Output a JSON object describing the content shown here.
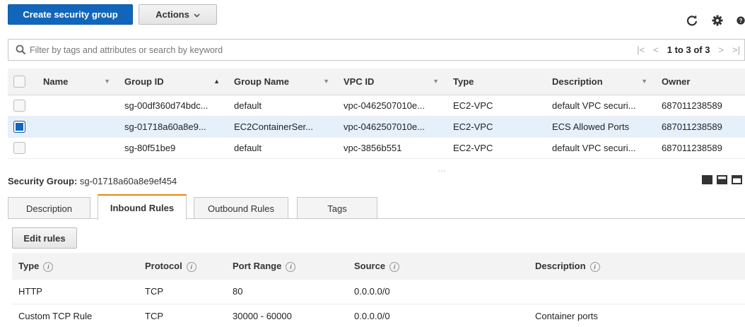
{
  "toolbar": {
    "create_label": "Create security group",
    "actions_label": "Actions",
    "icons": [
      "refresh-icon",
      "gear-icon",
      "help-icon"
    ]
  },
  "filter": {
    "placeholder": "Filter by tags and attributes or search by keyword",
    "pager_text": "1 to 3 of 3"
  },
  "grid": {
    "columns": [
      "Name",
      "Group ID",
      "Group Name",
      "VPC ID",
      "Type",
      "Description",
      "Owner"
    ],
    "rows": [
      {
        "name": "",
        "group_id": "sg-00df360d74bdc...",
        "group_name": "default",
        "vpc_id": "vpc-0462507010e...",
        "type": "EC2-VPC",
        "description": "default VPC securi...",
        "owner": "687011238589",
        "selected": false
      },
      {
        "name": "",
        "group_id": "sg-01718a60a8e9...",
        "group_name": "EC2ContainerSer...",
        "vpc_id": "vpc-0462507010e...",
        "type": "EC2-VPC",
        "description": "ECS Allowed Ports",
        "owner": "687011238589",
        "selected": true
      },
      {
        "name": "",
        "group_id": "sg-80f51be9",
        "group_name": "default",
        "vpc_id": "vpc-3856b551",
        "type": "EC2-VPC",
        "description": "default VPC securi...",
        "owner": "687011238589",
        "selected": false
      }
    ]
  },
  "detail": {
    "label": "Security Group:",
    "group_id": "sg-01718a60a8e9ef454",
    "tabs": [
      "Description",
      "Inbound Rules",
      "Outbound Rules",
      "Tags"
    ],
    "active_tab": "Inbound Rules",
    "edit_label": "Edit rules"
  },
  "rules": {
    "columns": [
      "Type",
      "Protocol",
      "Port Range",
      "Source",
      "Description"
    ],
    "rows": [
      {
        "type": "HTTP",
        "protocol": "TCP",
        "port_range": "80",
        "source": "0.0.0.0/0",
        "description": ""
      },
      {
        "type": "Custom TCP Rule",
        "protocol": "TCP",
        "port_range": "30000 - 60000",
        "source": "0.0.0.0/0",
        "description": "Container ports"
      }
    ]
  },
  "colors": {
    "primary": "#1166bb",
    "active_tab_accent": "#e8860c",
    "selected_row": "#e6f0fb"
  }
}
